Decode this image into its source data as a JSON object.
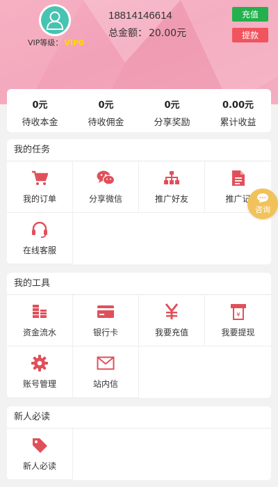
{
  "header": {
    "phone": "18814146614",
    "vip_label": "VIP等级：",
    "vip_level": "VIP0",
    "total_label": "总金额：",
    "total_amount": "20.00元",
    "recharge_label": "充值",
    "withdraw_label": "提款"
  },
  "stats": [
    {
      "value": "0元",
      "label": "待收本金"
    },
    {
      "value": "0元",
      "label": "待收佣金"
    },
    {
      "value": "0元",
      "label": "分享奖励"
    },
    {
      "value": "0.00元",
      "label": "累计收益"
    }
  ],
  "tasks": {
    "title": "我的任务",
    "items": [
      {
        "label": "我的订单",
        "icon": "cart-icon"
      },
      {
        "label": "分享微信",
        "icon": "wechat-icon"
      },
      {
        "label": "推广好友",
        "icon": "org-chart-icon"
      },
      {
        "label": "推广记",
        "icon": "document-icon"
      },
      {
        "label": "在线客服",
        "icon": "headset-icon"
      }
    ]
  },
  "tools": {
    "title": "我的工具",
    "items": [
      {
        "label": "资金流水",
        "icon": "coins-stack-icon"
      },
      {
        "label": "银行卡",
        "icon": "bank-card-icon"
      },
      {
        "label": "我要充值",
        "icon": "yen-icon"
      },
      {
        "label": "我要提现",
        "icon": "atm-withdraw-icon"
      },
      {
        "label": "账号管理",
        "icon": "gear-icon"
      },
      {
        "label": "站内信",
        "icon": "envelope-icon"
      }
    ]
  },
  "newbie": {
    "title": "新人必读",
    "items": [
      {
        "label": "新人必读",
        "icon": "tag-icon"
      }
    ]
  },
  "consult": {
    "label": "咨询"
  },
  "colors": {
    "accent": "#e0505a",
    "recharge": "#22b14c",
    "withdraw": "#f0545d",
    "avatar": "#47c3b1",
    "vip_level": "#ffd700",
    "consult": "#f2c25a"
  }
}
